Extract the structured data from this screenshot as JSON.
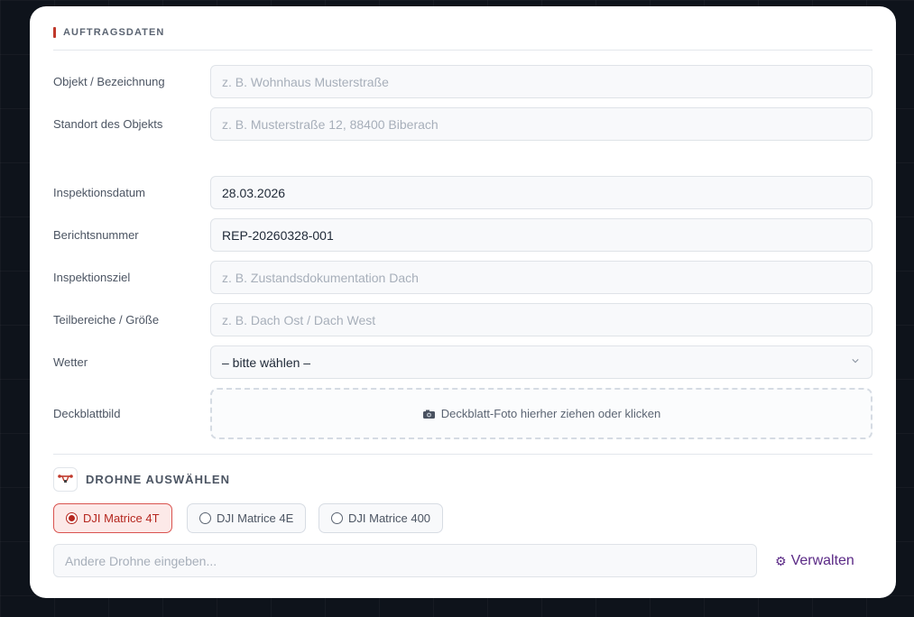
{
  "section": {
    "title": "AUFTRAGSDATEN"
  },
  "fields": {
    "objekt": {
      "label": "Objekt / Bezeichnung",
      "value": "",
      "placeholder": "z. B. Wohnhaus Musterstraße"
    },
    "standort": {
      "label": "Standort des Objekts",
      "value": "",
      "placeholder": "z. B. Musterstraße 12, 88400 Biberach"
    },
    "datum": {
      "label": "Inspektionsdatum",
      "value": "28.03.2026"
    },
    "bericht": {
      "label": "Berichtsnummer",
      "value": "REP-20260328-001"
    },
    "ziel": {
      "label": "Inspektionsziel",
      "value": "",
      "placeholder": "z. B. Zustandsdokumentation Dach"
    },
    "teilbereiche": {
      "label": "Teilbereiche / Größe",
      "value": "",
      "placeholder": "z. B. Dach Ost / Dach West"
    },
    "wetter": {
      "label": "Wetter",
      "selected": "– bitte wählen –"
    },
    "deckblatt": {
      "label": "Deckblattbild",
      "drop_text": "Deckblatt-Foto hierher ziehen oder klicken",
      "icon": "camera-icon"
    }
  },
  "drone": {
    "title": "DROHNE AUSWÄHLEN",
    "icon": "drone-icon",
    "options": [
      {
        "label": "DJI Matrice 4T",
        "selected": true
      },
      {
        "label": "DJI Matrice 4E",
        "selected": false
      },
      {
        "label": "DJI Matrice 400",
        "selected": false
      }
    ],
    "other_placeholder": "Andere Drohne eingeben...",
    "manage_label": "Verwalten",
    "manage_icon": "gear-icon"
  },
  "colors": {
    "accent": "#c0392b",
    "selected_bg": "#fce9e8",
    "manage": "#5b2a86"
  }
}
